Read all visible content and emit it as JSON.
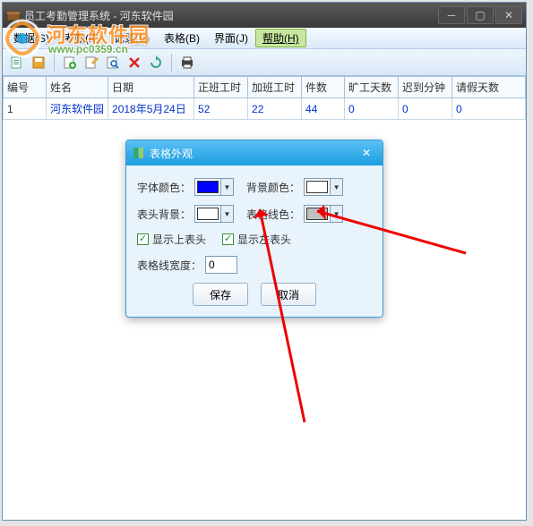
{
  "window": {
    "title": "员工考勤管理系统  -  河东软件园"
  },
  "menu": {
    "items": [
      "数据(S)",
      "考勤(K)",
      "记录(E)",
      "表格(B)",
      "界面(J)"
    ],
    "help": "帮助(H)"
  },
  "table": {
    "headers": [
      "编号",
      "姓名",
      "日期",
      "正班工时",
      "加班工时",
      "件数",
      "旷工天数",
      "迟到分钟",
      "请假天数"
    ],
    "row": {
      "id": "1",
      "name": "河东软件园",
      "date": "2018年5月24日",
      "regular": "52",
      "overtime": "22",
      "pieces": "44",
      "absent": "0",
      "late": "0",
      "leave": "0"
    }
  },
  "dialog": {
    "title": "表格外观",
    "font_color_label": "字体颜色：",
    "bg_color_label": "背景颜色：",
    "header_bg_label": "表头背景：",
    "line_color_label": "表格线色：",
    "show_top_header": "显示上表头",
    "show_left_header": "显示左表头",
    "line_width_label": "表格线宽度：",
    "line_width_value": "0",
    "save": "保存",
    "cancel": "取消",
    "colors": {
      "font": "#0000ff",
      "bg": "#ffffff",
      "header_bg": "#ffffff",
      "line": "#c0c0c0"
    }
  },
  "watermark": {
    "text": "河东软件园",
    "url": "www.pc0359.cn"
  }
}
